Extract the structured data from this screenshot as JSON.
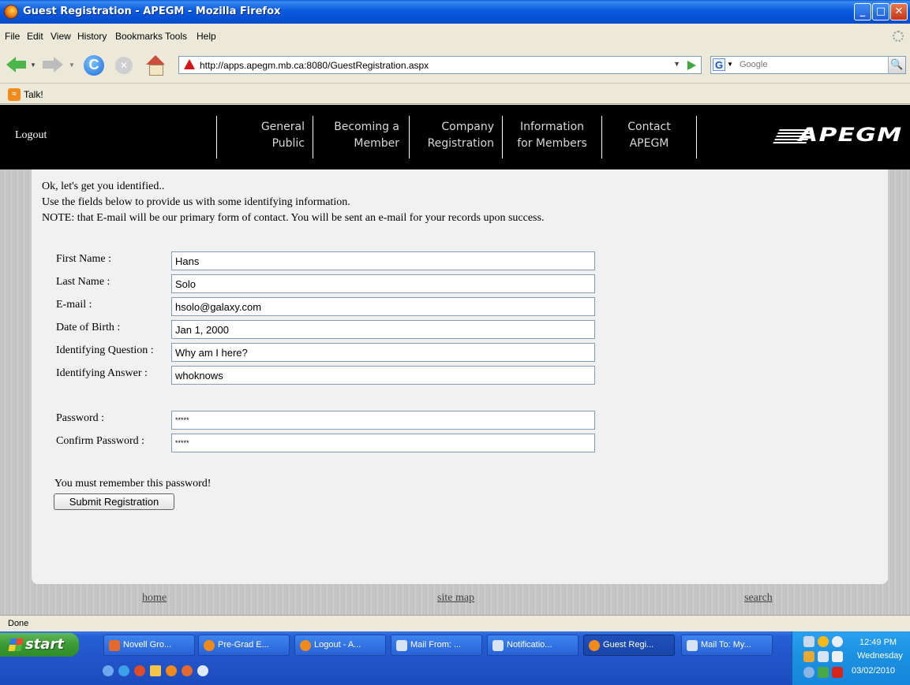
{
  "window": {
    "title": "Guest Registration - APEGM - Mozilla Firefox",
    "minimize_glyph": "_",
    "maximize_glyph": "□",
    "close_glyph": "✕"
  },
  "menu": [
    "File",
    "Edit",
    "View",
    "History",
    "Bookmarks",
    "Tools",
    "Help"
  ],
  "nav": {
    "back_icon": "back-arrow-icon",
    "forward_icon": "forward-arrow-icon",
    "reload_glyph": "C",
    "stop_glyph": "✕",
    "url": "http://apps.apegm.mb.ca:8080/GuestRegistration.aspx",
    "url_dropdown_glyph": "▼",
    "search_engine_glyph": "G",
    "search_engine_drop_glyph": "▼",
    "search_placeholder": "Google",
    "search_go_glyph": "🔍"
  },
  "bookmarks": {
    "rss_glyph": "≈",
    "items": [
      "Talk!"
    ]
  },
  "site_nav": {
    "logout": "Logout",
    "items": [
      {
        "line1": "General",
        "line2": "Public"
      },
      {
        "line1": "Becoming a",
        "line2": "Member"
      },
      {
        "line1": "Company",
        "line2": "Registration"
      },
      {
        "line1": "Information",
        "line2": "for Members"
      },
      {
        "line1": "Contact",
        "line2": "APEGM"
      }
    ],
    "logo_text": "APEGM"
  },
  "form": {
    "intro": [
      "Ok, let's get you identified..",
      "Use the fields below to provide us with some identifying information.",
      "NOTE: that E-mail will be our primary form of contact.  You will be sent an e-mail for your records upon success."
    ],
    "fields": [
      {
        "label": "First Name :",
        "value": "Hans"
      },
      {
        "label": "Last Name :",
        "value": "Solo"
      },
      {
        "label": "E-mail :",
        "value": "hsolo@galaxy.com"
      },
      {
        "label": "Date of Birth :",
        "value": "Jan 1, 2000"
      },
      {
        "label": "Identifying Question :",
        "value": "Why am I here?"
      },
      {
        "label": "Identifying Answer :",
        "value": "whoknows"
      }
    ],
    "password": {
      "label": "Password :",
      "value": "*****"
    },
    "confirm_password": {
      "label": "Confirm Password :",
      "value": "*****"
    },
    "remember_note": "You must remember this password!",
    "submit_label": "Submit Registration"
  },
  "footer": {
    "home": "home",
    "site_map": "site map",
    "search": "search"
  },
  "status": "Done",
  "taskbar": {
    "start_label": "start",
    "tasks": [
      {
        "label": "Novell Gro...",
        "icon": "#e36a2c",
        "active": false
      },
      {
        "label": "Pre-Grad E...",
        "icon": "#f08a1a",
        "active": false
      },
      {
        "label": "Logout - A...",
        "icon": "#f08a1a",
        "active": false
      },
      {
        "label": "Mail From: ...",
        "icon": "#d8e4f4",
        "active": false
      },
      {
        "label": "Notificatio...",
        "icon": "#d8e4f4",
        "active": false
      },
      {
        "label": "Guest Regi...",
        "icon": "#f08a1a",
        "active": true
      },
      {
        "label": "Mail To: My...",
        "icon": "#d8e4f4",
        "active": false
      }
    ],
    "clock_time": "12:49 PM",
    "clock_day": "Wednesday",
    "clock_date": "03/02/2010"
  }
}
